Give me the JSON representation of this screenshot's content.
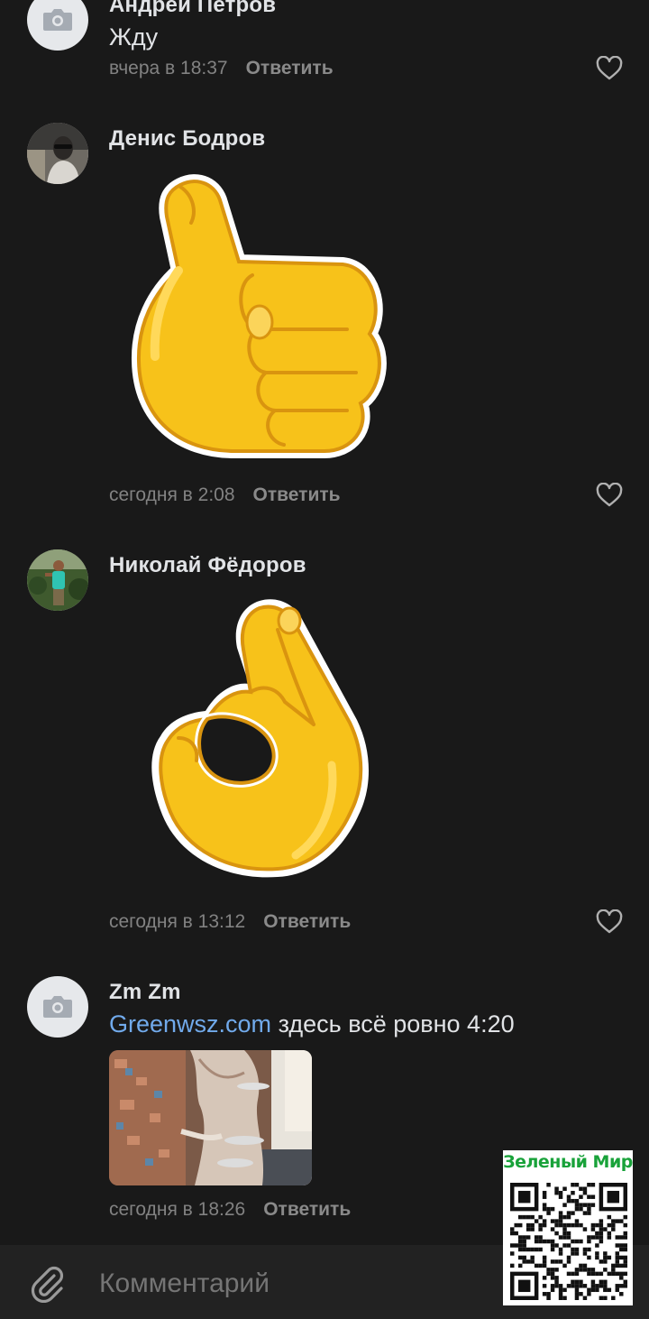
{
  "comments": [
    {
      "author": "Андрей Петров",
      "text": "Жду",
      "time": "вчера в 18:37",
      "reply": "Ответить",
      "avatar": "camera-placeholder",
      "like_icon": "heart-outline-icon"
    },
    {
      "author": "Денис Бодров",
      "sticker": "thumbs-up-sticker",
      "time": "сегодня в 2:08",
      "reply": "Ответить",
      "avatar": "photo",
      "like_icon": "heart-outline-icon"
    },
    {
      "author": "Николай Фёдоров",
      "sticker": "ok-hand-sticker",
      "time": "сегодня в 13:12",
      "reply": "Ответить",
      "avatar": "photo",
      "like_icon": "heart-outline-icon"
    },
    {
      "author": "Zm Zm",
      "link": "Greenwsz.com",
      "text": " здесь всё ровно 4:20",
      "attachment": "photo",
      "time": "сегодня в 18:26",
      "reply": "Ответить",
      "avatar": "camera-placeholder"
    }
  ],
  "composer": {
    "placeholder": "Комментарий",
    "attach_icon": "paperclip-icon"
  },
  "watermark": {
    "title": "Зеленый Мир",
    "qr": "qr-code"
  },
  "colors": {
    "background": "#191919",
    "link": "#71aaeb",
    "meta": "#828282",
    "bar": "#222222",
    "watermark_green": "#19a23a"
  }
}
